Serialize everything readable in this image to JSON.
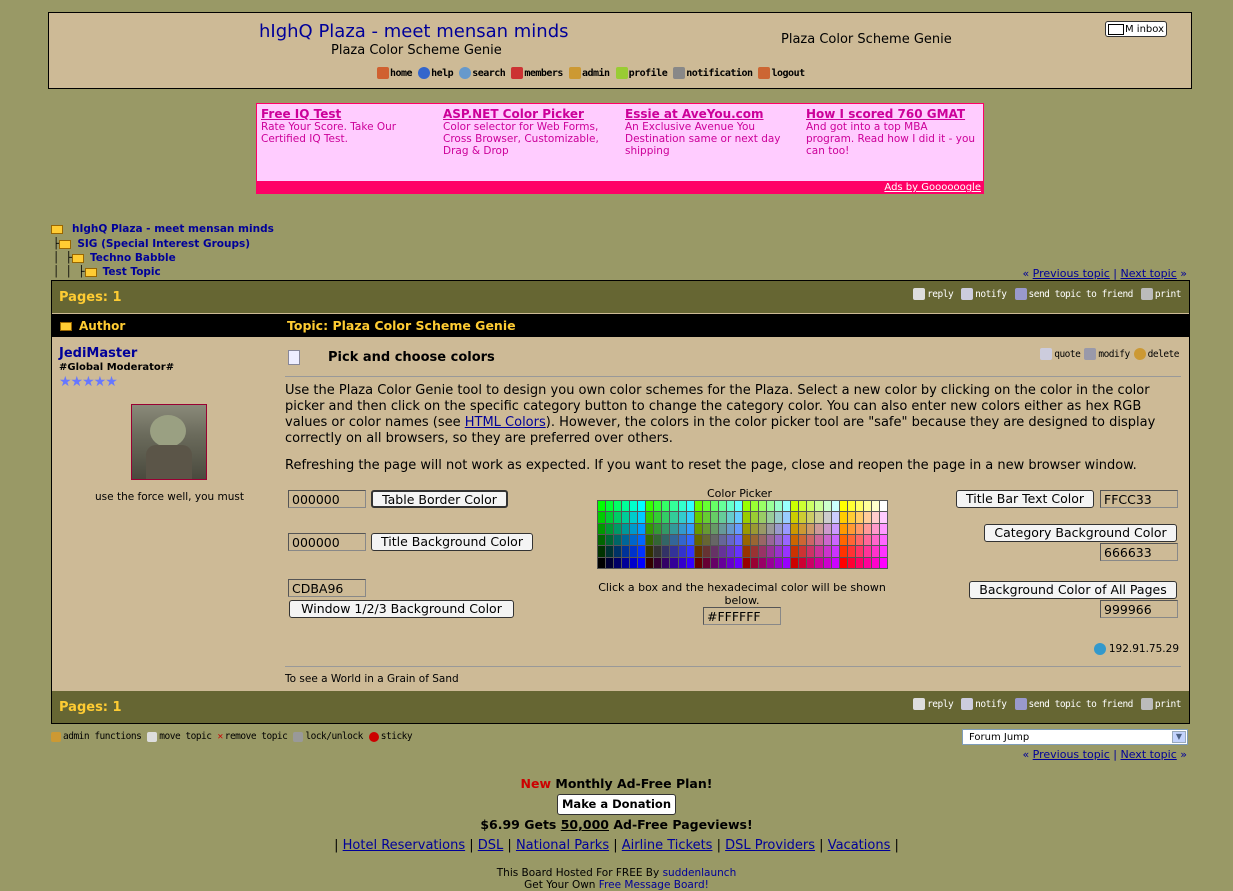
{
  "header": {
    "site_title": "hIghQ Plaza - meet mensan minds",
    "site_subtitle": "Plaza Color Scheme Genie",
    "page_heading": "Plaza Color Scheme Genie",
    "im_inbox": "IM inbox"
  },
  "nav": [
    "home",
    "help",
    "search",
    "members",
    "admin",
    "profile",
    "notification",
    "logout"
  ],
  "ads": [
    {
      "title": "Free IQ Test",
      "body": "Rate Your Score. Take Our Certified IQ Test."
    },
    {
      "title": "ASP.NET Color Picker",
      "body": "Color selector for Web Forms, Cross Browser, Customizable, Drag & Drop"
    },
    {
      "title": "Essie at AveYou.com",
      "body": "An Exclusive Avenue You Destination same or next day shipping"
    },
    {
      "title": "How I scored 760 GMAT",
      "body": "And got into a top MBA program. Read how I did it - you can too!"
    }
  ],
  "ads_credit": "Ads by Goooooogle",
  "breadcrumb": [
    "hIghQ Plaza - meet mensan minds",
    "SIG (Special Interest Groups)",
    "Techno Babble",
    "Test Topic"
  ],
  "topic_nav": {
    "prev": "Previous topic",
    "next": "Next topic"
  },
  "pages_label": "Pages: 1",
  "topic_tools": [
    "reply",
    "notify",
    "send topic to friend",
    "print"
  ],
  "columns": {
    "author": "Author",
    "topic": "Topic: Plaza Color Scheme Genie"
  },
  "author": {
    "name": "JediMaster",
    "rank": "#Global Moderator#",
    "stars": "★★★★★",
    "quote": "use the force well, you must"
  },
  "post": {
    "title": "Pick and choose colors",
    "tools": [
      "quote",
      "modify",
      "delete"
    ],
    "para1_a": "Use the Plaza Color Genie tool to design you own color schemes for the Plaza. Select a new color by clicking on the color in the color picker and then click on the specific category button to change the category color. You can also enter new colors either as hex RGB values or color names (see ",
    "para1_link": "HTML Colors",
    "para1_b": "). However, the colors in the color picker tool are \"safe\" because they are designed to display correctly on all browsers, so they are preferred over others.",
    "para2": "Refreshing the page will not work as expected. If you want to reset the page, close and reopen the page in a new browser window.",
    "ip": "192.91.75.29",
    "signature": "To see a World in a Grain of Sand"
  },
  "genie": {
    "table_border": {
      "value": "000000",
      "label": "Table Border Color"
    },
    "title_background": {
      "value": "000000",
      "label": "Title Background Color"
    },
    "window_background": {
      "value": "CDBA96",
      "label": "Window 1/2/3 Background Color"
    },
    "title_bar_text": {
      "value": "FFCC33",
      "label": "Title Bar Text Color"
    },
    "category_background": {
      "value": "666633",
      "label": "Category Background Color"
    },
    "page_background": {
      "value": "999966",
      "label": "Background Color of All Pages"
    },
    "picker_label": "Color Picker",
    "picker_hint": "Click a box and the hexadecimal color will be shown below.",
    "picked_value": "#FFFFFF"
  },
  "admin_tools": [
    "admin functions",
    "move topic",
    "remove topic",
    "lock/unlock",
    "sticky"
  ],
  "forum_jump": "Forum Jump",
  "promo": {
    "new": "New",
    "plan": "Monthly Ad-Free Plan!",
    "donate": "Make a Donation",
    "price": "$6.99 Gets",
    "count": "50,000",
    "suffix": "Ad-Free Pageviews!"
  },
  "footer_links": [
    "Hotel Reservations",
    "DSL",
    "National Parks",
    "Airline Tickets",
    "DSL Providers",
    "Vacations"
  ],
  "hosted": {
    "line1_a": "This Board Hosted For FREE By",
    "line1_link": "suddenlaunch",
    "line2_a": "Get Your Own",
    "line2_link": "Free Message Board!"
  },
  "colors": {
    "page_bg": "#999966",
    "window_bg": "#CDBA96",
    "category_bg": "#666633",
    "title_text": "#FFCC33",
    "link": "#000099",
    "ad_bg": "#FFCCFF",
    "ad_accent": "#FF0066"
  }
}
